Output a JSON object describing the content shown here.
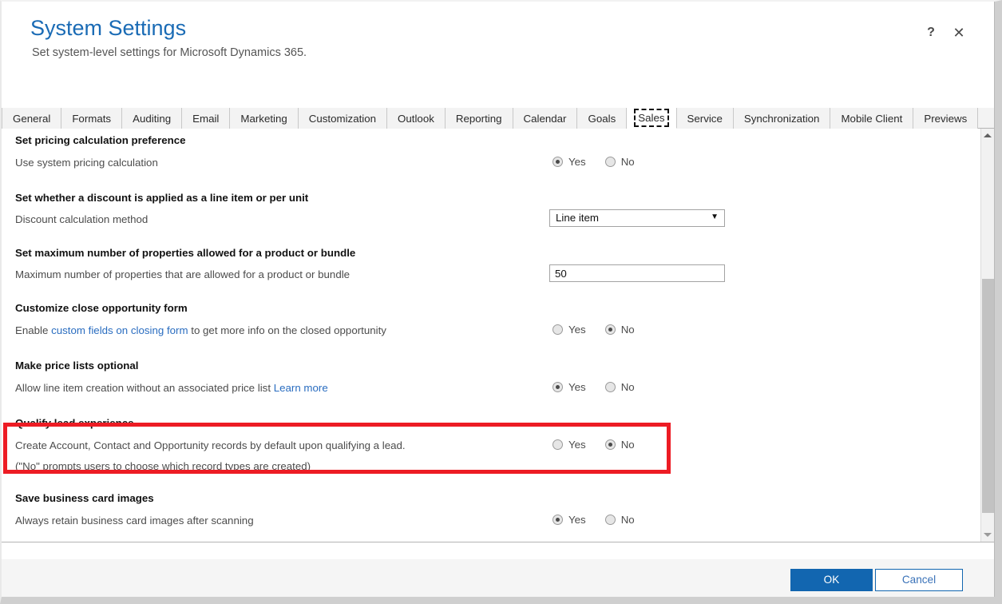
{
  "header": {
    "title": "System Settings",
    "subtitle": "Set system-level settings for Microsoft Dynamics 365.",
    "help_icon": "?",
    "close_icon": "✕"
  },
  "tabs": [
    {
      "label": "General",
      "active": false
    },
    {
      "label": "Formats",
      "active": false
    },
    {
      "label": "Auditing",
      "active": false
    },
    {
      "label": "Email",
      "active": false
    },
    {
      "label": "Marketing",
      "active": false
    },
    {
      "label": "Customization",
      "active": false
    },
    {
      "label": "Outlook",
      "active": false
    },
    {
      "label": "Reporting",
      "active": false
    },
    {
      "label": "Calendar",
      "active": false
    },
    {
      "label": "Goals",
      "active": false
    },
    {
      "label": "Sales",
      "active": true
    },
    {
      "label": "Service",
      "active": false
    },
    {
      "label": "Synchronization",
      "active": false
    },
    {
      "label": "Mobile Client",
      "active": false
    },
    {
      "label": "Previews",
      "active": false
    }
  ],
  "sections": [
    {
      "heading": "Set pricing calculation preference",
      "desc": "Use system pricing calculation",
      "control": "radio",
      "yes_label": "Yes",
      "no_label": "No",
      "selected": "yes"
    },
    {
      "heading": "Set whether a discount is applied as a line item or per unit",
      "desc": "Discount calculation method",
      "control": "select",
      "value": "Line item",
      "arrow": "▼"
    },
    {
      "heading": "Set maximum number of properties allowed for a product or bundle",
      "desc": "Maximum number of properties that are allowed for a product or bundle",
      "control": "input",
      "value": "50"
    },
    {
      "heading": "Customize close opportunity form",
      "desc_pre": "Enable ",
      "desc_link": "custom fields on closing form",
      "desc_post": " to get more info on the closed opportunity",
      "control": "radio",
      "yes_label": "Yes",
      "no_label": "No",
      "selected": "no",
      "highlighted": true
    },
    {
      "heading": "Make price lists optional",
      "desc_pre": "Allow line item creation without an associated price list ",
      "desc_link": "Learn more",
      "desc_post": "",
      "control": "radio",
      "yes_label": "Yes",
      "no_label": "No",
      "selected": "yes"
    },
    {
      "heading": "Qualify lead experience",
      "desc": "Create Account, Contact and Opportunity records by default upon qualifying a lead.",
      "desc2": "(\"No\" prompts users to choose which record types are created)",
      "control": "radio",
      "yes_label": "Yes",
      "no_label": "No",
      "selected": "no"
    },
    {
      "heading": "Save business card images",
      "desc": "Always retain business card images after scanning",
      "control": "radio",
      "yes_label": "Yes",
      "no_label": "No",
      "selected": "yes"
    }
  ],
  "highlight": {
    "color": "#ed1c24"
  },
  "scrollbar": {
    "up_arrow": "▲",
    "down_arrow": "▼"
  },
  "footer": {
    "ok_label": "OK",
    "cancel_label": "Cancel"
  },
  "colors": {
    "title_blue": "#1a6bb5",
    "link_blue": "#2a6dc0",
    "primary_button": "#1266b0",
    "highlight_red": "#ed1c24"
  }
}
